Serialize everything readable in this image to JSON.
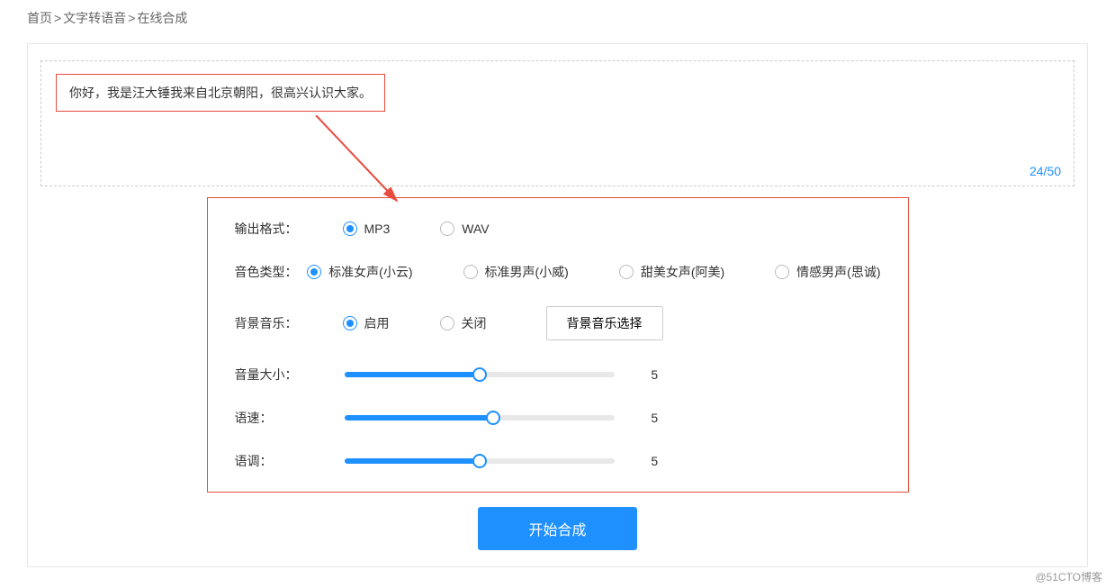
{
  "breadcrumb": {
    "home": "首页",
    "tts": "文字转语音",
    "page": "在线合成"
  },
  "textInput": {
    "value": "你好，我是汪大锤我来自北京朝阳，很高兴认识大家。",
    "counter": "24/50"
  },
  "settings": {
    "format": {
      "label": "输出格式：",
      "options": [
        "MP3",
        "WAV"
      ],
      "selected": 0
    },
    "voice": {
      "label": "音色类型：",
      "options": [
        "标准女声(小云)",
        "标准男声(小威)",
        "甜美女声(阿美)",
        "情感男声(思诚)"
      ],
      "selected": 0
    },
    "bgm": {
      "label": "背景音乐：",
      "options": [
        "启用",
        "关闭"
      ],
      "selected": 0,
      "button": "背景音乐选择"
    },
    "volume": {
      "label": "音量大小：",
      "value": "5",
      "percent": 50
    },
    "speed": {
      "label": "语速：",
      "value": "5",
      "percent": 55
    },
    "pitch": {
      "label": "语调：",
      "value": "5",
      "percent": 50
    }
  },
  "submit": "开始合成",
  "watermark": "@51CTO博客"
}
